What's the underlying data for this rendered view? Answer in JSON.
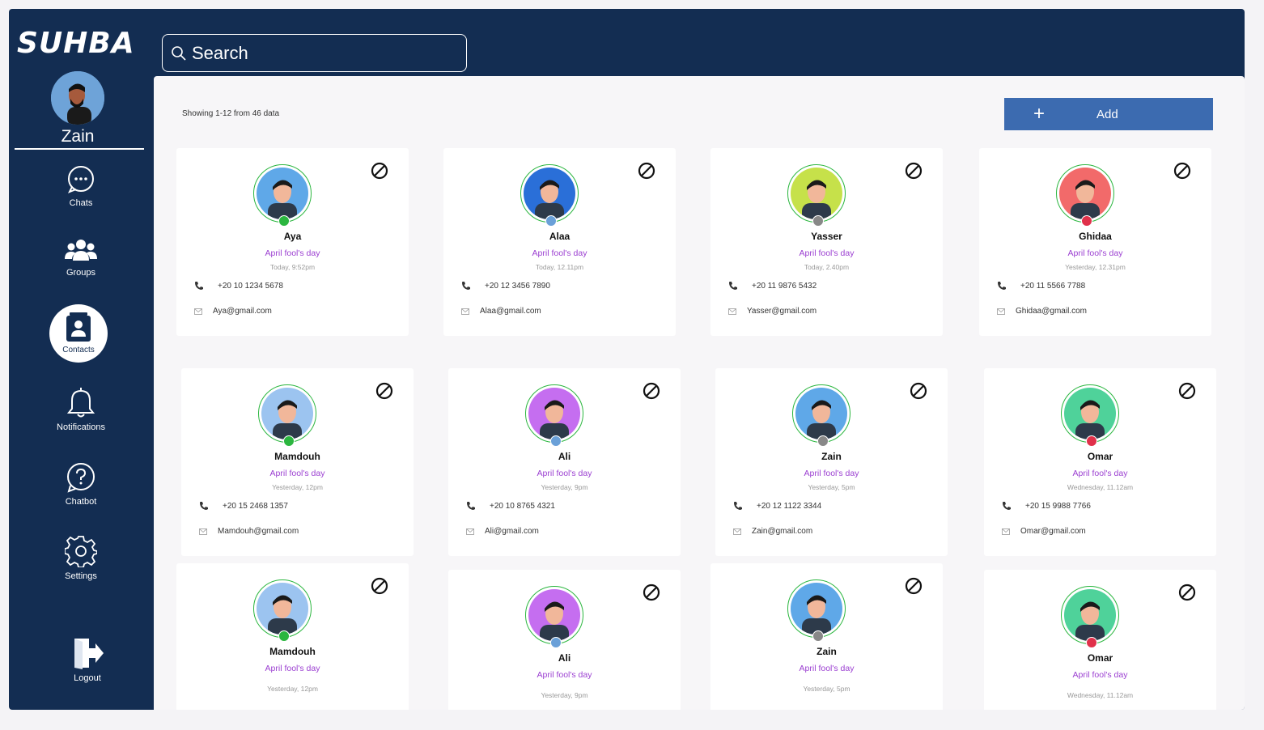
{
  "app": {
    "logo": "SUHBA"
  },
  "search": {
    "placeholder": "Search"
  },
  "profile": {
    "name": "Zain"
  },
  "nav": {
    "chats": "Chats",
    "groups": "Groups",
    "contacts": "Contacts",
    "notifications": "Notifications",
    "chatbot": "Chatbot",
    "settings": "Settings",
    "logout": "Logout"
  },
  "main": {
    "showing": "Showing 1-12 from 46 data",
    "add_label": "Add",
    "add_icon": "+",
    "contacts": [
      {
        "name": "Aya",
        "event": "April fool's day",
        "time": "Today, 9:52pm",
        "phone": "+20 10 1234 5678",
        "email": "Aya@gmail.com",
        "bg": "#5fa8e8",
        "status": "#2bb63f"
      },
      {
        "name": "Alaa",
        "event": "April fool's day",
        "time": "Today, 12.11pm",
        "phone": "+20 12 3456 7890",
        "email": "Alaa@gmail.com",
        "bg": "#2a6fd8",
        "status": "#6aa0d8"
      },
      {
        "name": "Yasser",
        "event": "April fool's day",
        "time": "Today, 2.40pm",
        "phone": "+20 11 9876 5432",
        "email": "Yasser@gmail.com",
        "bg": "#c6e14a",
        "status": "#888888"
      },
      {
        "name": "Ghidaa",
        "event": "April fool's day",
        "time": "Yesterday, 12.31pm",
        "phone": "+20 11 5566 7788",
        "email": "Ghidaa@gmail.com",
        "bg": "#f26a6a",
        "status": "#e0314a"
      },
      {
        "name": "Mamdouh",
        "event": "April fool's day",
        "time": "Yesterday, 12pm",
        "phone": "+20 15 2468 1357",
        "email": "Mamdouh@gmail.com",
        "bg": "#9cc4f0",
        "status": "#2bb63f"
      },
      {
        "name": "Ali",
        "event": "April fool's day",
        "time": "Yesterday, 9pm",
        "phone": "+20 10 8765 4321",
        "email": "Ali@gmail.com",
        "bg": "#c56ef0",
        "status": "#6aa0d8"
      },
      {
        "name": "Zain",
        "event": "April fool's day",
        "time": "Yesterday, 5pm",
        "phone": "+20 12 1122 3344",
        "email": "Zain@gmail.com",
        "bg": "#5fa8e8",
        "status": "#888888"
      },
      {
        "name": "Omar",
        "event": "April fool's day",
        "time": "Wednesday, 11.12am",
        "phone": "+20 15 9988 7766",
        "email": "Omar@gmail.com",
        "bg": "#4fd29a",
        "status": "#e0314a"
      },
      {
        "name": "Mamdouh",
        "event": "April fool's day",
        "time": "Yesterday, 12pm",
        "bg": "#9cc4f0",
        "status": "#2bb63f"
      },
      {
        "name": "Ali",
        "event": "April fool's day",
        "time": "Yesterday, 9pm",
        "bg": "#c56ef0",
        "status": "#6aa0d8"
      },
      {
        "name": "Zain",
        "event": "April fool's day",
        "time": "Yesterday, 5pm",
        "bg": "#5fa8e8",
        "status": "#888888"
      },
      {
        "name": "Omar",
        "event": "April fool's day",
        "time": "Wednesday, 11.12am",
        "bg": "#4fd29a",
        "status": "#e0314a"
      }
    ]
  },
  "colors": {
    "sidebar": "#132d52",
    "accent": "#3c6bb0",
    "event": "#9b3fd1",
    "online": "#2bb63f"
  },
  "icons": [
    "search-icon",
    "chat-bubble-icon",
    "groups-icon",
    "contacts-icon",
    "bell-icon",
    "question-icon",
    "gear-icon",
    "logout-icon",
    "block-icon",
    "phone-icon",
    "email-icon",
    "plus-icon"
  ]
}
